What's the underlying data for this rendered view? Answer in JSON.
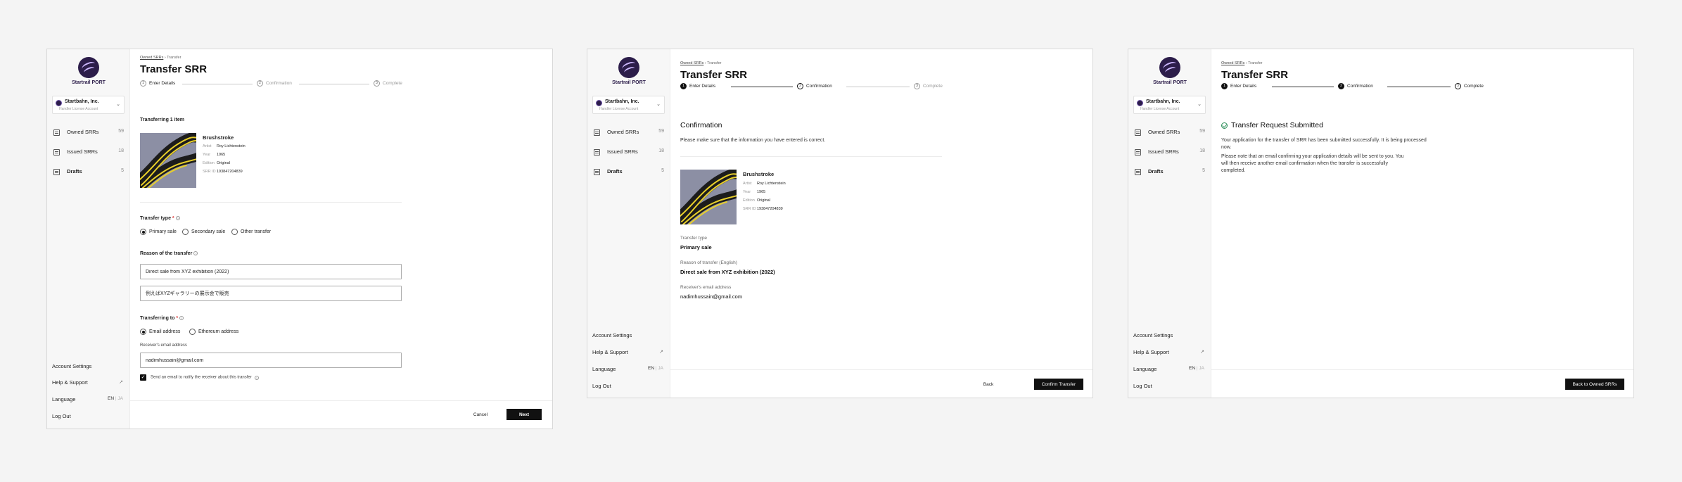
{
  "sidebar": {
    "logo_text": "Startrail PORT",
    "org_name": "Startbahn, Inc.",
    "org_sub": "Handler License Account",
    "nav": [
      {
        "label": "Owned SRRs",
        "count": "59"
      },
      {
        "label": "Issued SRRs",
        "count": "18"
      },
      {
        "label": "Drafts",
        "count": "5"
      }
    ],
    "account_settings": "Account Settings",
    "help_support": "Help & Support",
    "language_label": "Language",
    "lang_en": "EN",
    "lang_sep": "|",
    "lang_ja": "JA",
    "logout": "Log Out"
  },
  "common": {
    "crumb_owned": "Owned SRRs",
    "crumb_sep": "›",
    "crumb_transfer": "Transfer",
    "title": "Transfer SRR",
    "steps": [
      {
        "num": "1",
        "label": "Enter Details"
      },
      {
        "num": "2",
        "label": "Confirmation"
      },
      {
        "num": "3",
        "label": "Complete"
      }
    ],
    "check": "✓"
  },
  "artwork": {
    "title": "Brushstroke",
    "artist_key": "Artist",
    "artist": "Roy Lichtenstein",
    "year_key": "Year",
    "year": "1965",
    "edition_key": "Edition",
    "edition": "Original",
    "srr_key": "SRR ID",
    "srr_id": "193847204839"
  },
  "screen1": {
    "transferring_count": "Transferring 1 item",
    "transfer_type_label": "Transfer type",
    "required_mark": "*",
    "info": "?",
    "transfer_types": [
      "Primary sale",
      "Secondary sale",
      "Other transfer"
    ],
    "reason_label": "Reason of the transfer",
    "reason_en": "Direct sale from XYZ exhibition (2022)",
    "reason_ja": "例えばXYZギャラリーの展示会で販売",
    "transferring_to_label": "Transferring to",
    "destinations": [
      "Email address",
      "Ethereum address"
    ],
    "receiver_email_label": "Receiver's email address",
    "receiver_email": "nadimhussain@gmail.com",
    "notify_label": "Send an email to notify the receiver about this transfer",
    "cancel": "Cancel",
    "next": "Next"
  },
  "screen2": {
    "heading": "Confirmation",
    "subtext": "Please make sure that the information you have entered is correct.",
    "type_label": "Transfer type",
    "type_value": "Primary sale",
    "reason_label": "Reason of transfer (English)",
    "reason_value": "Direct sale from XYZ exhibition (2022)",
    "email_label": "Receiver's email address",
    "email_value": "nadimhussain@gmail.com",
    "back": "Back",
    "confirm": "Confirm Transfer"
  },
  "screen3": {
    "heading": "Transfer Request Submitted",
    "para1": "Your application for the transfer of SRR has been submitted successfully. It is being processed now.",
    "para2": "Please note that an email confirming your application details will be sent to you. You will then receive another email confirmation when the transfer is successfully completed.",
    "back_owned": "Back to Owned SRRs"
  },
  "colors": {
    "accent": "#111111",
    "brand": "#2c1d4a",
    "success": "#2f8f5b",
    "required": "#dd3333"
  }
}
